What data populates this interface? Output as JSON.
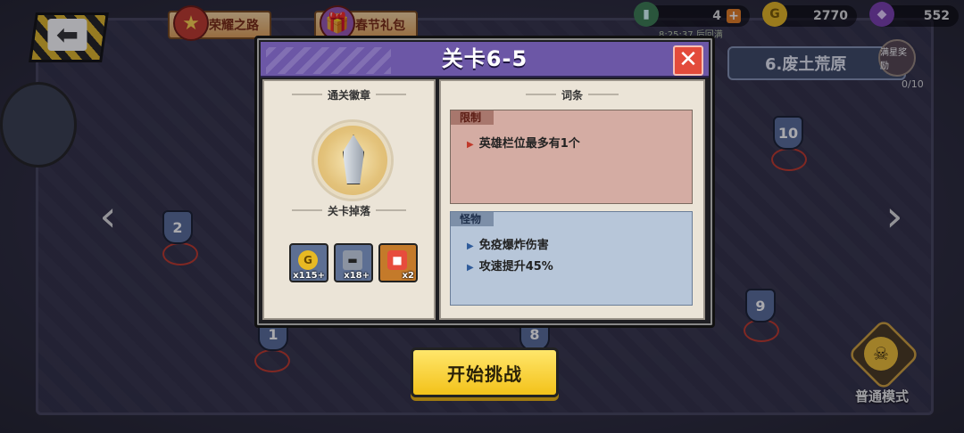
{
  "topbar": {
    "tabs": [
      {
        "label": "荣耀之路"
      },
      {
        "label": "春节礼包"
      }
    ],
    "resources": {
      "energy": "4",
      "energy_timer": "8:25:37 后回满",
      "gold": "2770",
      "gems": "552"
    }
  },
  "chapter": {
    "title": "6.废土荒原",
    "reward_label": "满星奖励",
    "progress": "0/10"
  },
  "map": {
    "nodes": [
      "1",
      "2",
      "8",
      "9",
      "10"
    ]
  },
  "mode": {
    "label": "普通模式"
  },
  "dialog": {
    "title": "关卡6-5",
    "left": {
      "badge_header": "通关徽章",
      "drops_header": "关卡掉落",
      "drops": [
        {
          "icon": "gold-coin-icon",
          "count": "x115+"
        },
        {
          "icon": "iron-anvil-icon",
          "count": "x18+"
        },
        {
          "icon": "treasure-box-icon",
          "count": "x2"
        }
      ]
    },
    "right": {
      "header": "词条",
      "restriction": {
        "title": "限制",
        "lines": [
          "英雄栏位最多有1个"
        ]
      },
      "monster": {
        "title": "怪物",
        "lines": [
          "免疫爆炸伤害",
          "攻速提升45%"
        ]
      }
    },
    "start_button": "开始挑战"
  },
  "colors": {
    "dialog_header": "#6c57a6",
    "close_button": "#e34b3b",
    "start_button": "#f3c21a",
    "restriction_bg": "#d4aca3",
    "monster_bg": "#b7c6d9"
  }
}
